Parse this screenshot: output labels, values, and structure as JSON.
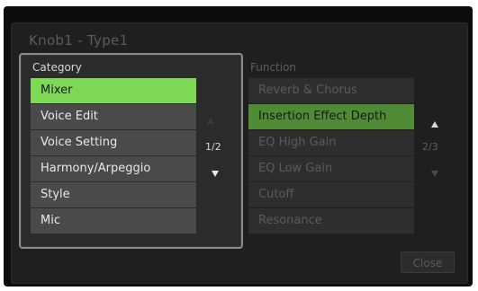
{
  "dialog": {
    "title": "Knob1 - Type1"
  },
  "category": {
    "label": "Category",
    "items": [
      {
        "label": "Mixer",
        "selected": true
      },
      {
        "label": "Voice Edit",
        "selected": false
      },
      {
        "label": "Voice Setting",
        "selected": false
      },
      {
        "label": "Harmony/Arpeggio",
        "selected": false
      },
      {
        "label": "Style",
        "selected": false
      },
      {
        "label": "Mic",
        "selected": false
      }
    ],
    "page": "1/2",
    "up_icon": "triangle-up-icon",
    "down_icon": "triangle-down-icon"
  },
  "function": {
    "label": "Function",
    "items": [
      {
        "label": "Reverb & Chorus",
        "selected": false
      },
      {
        "label": "Insertion Effect Depth",
        "selected": true
      },
      {
        "label": "EQ High Gain",
        "selected": false
      },
      {
        "label": "EQ Low Gain",
        "selected": false
      },
      {
        "label": "Cutoff",
        "selected": false
      },
      {
        "label": "Resonance",
        "selected": false
      }
    ],
    "page": "2/3",
    "up_icon": "triangle-up-icon",
    "down_icon": "triangle-down-icon"
  },
  "close_button": {
    "label": "Close"
  },
  "colors": {
    "category_selected": "#7ed957",
    "function_selected": "#4f8a34",
    "background": "#0c0c0c"
  }
}
